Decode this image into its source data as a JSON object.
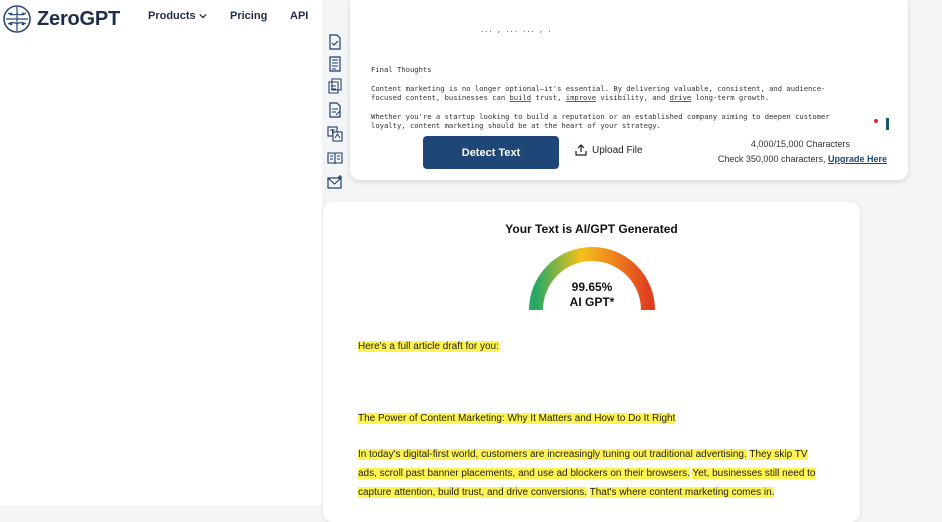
{
  "header": {
    "brand": "ZeroGPT",
    "nav": [
      {
        "label": "Products",
        "has_dropdown": true
      },
      {
        "label": "Pricing"
      },
      {
        "label": "API"
      }
    ]
  },
  "sidebar_tools": [
    "document-check-icon",
    "document-lines-icon",
    "document-stack-icon",
    "document-edit-icon",
    "translate-icon",
    "book-icon",
    "mail-icon"
  ],
  "editor": {
    "partial_top_line": "... , ... ... , .",
    "final_heading": "Final Thoughts",
    "paragraph1_a": "Content marketing is no longer optional—it's essential. By delivering valuable, consistent, and audience-",
    "paragraph1_b_pre": "focused content, businesses can ",
    "paragraph1_b_u1": "build",
    "paragraph1_b_mid1": " trust, ",
    "paragraph1_b_u2": "improve",
    "paragraph1_b_mid2": " visibility, and ",
    "paragraph1_b_u3": "drive",
    "paragraph1_b_post": " long-term growth.",
    "paragraph2_a": "Whether you're a startup looking to build a reputation or an established company aiming to deepen customer",
    "paragraph2_b": "loyalty, content marketing should be at the heart of your strategy.",
    "detect_button": "Detect Text",
    "upload_label": "Upload File",
    "char_count": "4,000/15,000 Characters",
    "check_text": "Check 350,000 characters, ",
    "upgrade_link": "Upgrade Here"
  },
  "result": {
    "title": "Your Text is AI/GPT Generated",
    "score_percent": "99.65%",
    "score_label": "AI GPT*",
    "score_value": 99.65,
    "gauge_colors": [
      "#2aa866",
      "#f3c11a",
      "#f08c1c",
      "#e0401f"
    ],
    "highlighted": {
      "intro": "Here's a full article draft for you:",
      "article_title": "The Power of Content Marketing: Why It Matters and How to Do It Right",
      "p1_s1": "In today's digital-first world, customers are increasingly tuning out traditional advertising.",
      "p1_s2": "They skip TV ads, scroll past banner placements, and use ad blockers on their browsers.",
      "p1_s3": "Yet, businesses still need to capture attention, build trust, and drive conversions.",
      "p1_s4": "That's where content marketing comes in."
    },
    "highlight_color": "#fff44f"
  }
}
